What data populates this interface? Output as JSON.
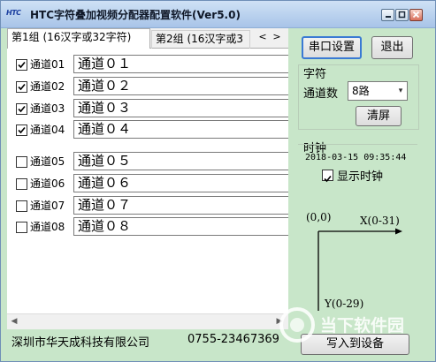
{
  "window": {
    "logo": "HTC",
    "title": "HTC字符叠加视频分配器配置软件(Ver5.0)"
  },
  "tabs": [
    {
      "label": "第1组 (16汉字或32字符)"
    },
    {
      "label": "第2组 (16汉字或3"
    }
  ],
  "tab_scroll": {
    "left": "<",
    "right": ">"
  },
  "channels": [
    {
      "label": "通道01",
      "checked": true,
      "value": "通道０１"
    },
    {
      "label": "通道02",
      "checked": true,
      "value": "通道０２"
    },
    {
      "label": "通道03",
      "checked": true,
      "value": "通道０３"
    },
    {
      "label": "通道04",
      "checked": true,
      "value": "通道０４"
    },
    {
      "label": "通道05",
      "checked": false,
      "value": "通道０５"
    },
    {
      "label": "通道06",
      "checked": false,
      "value": "通道０６"
    },
    {
      "label": "通道07",
      "checked": false,
      "value": "通道０７"
    },
    {
      "label": "通道08",
      "checked": false,
      "value": "通道０８"
    }
  ],
  "footer": {
    "company": "深圳市华天成科技有限公司",
    "phone": "0755-23467369"
  },
  "right": {
    "serial_button": "串口设置",
    "exit_button": "退出",
    "char_group_label": "字符",
    "channel_count_label": "通道数",
    "channel_count_value": "8路",
    "clear_button": "清屏",
    "clock_label": "时钟",
    "clock_value": "2018-03-15 09:35:44",
    "show_clock_label": "显示时钟",
    "show_clock_checked": true,
    "write_button": "写入到设备"
  },
  "diagram": {
    "origin": "(0,0)",
    "x_label": "X(0-31)",
    "y_label": "Y(0-29)"
  },
  "watermark": "当下软件园"
}
